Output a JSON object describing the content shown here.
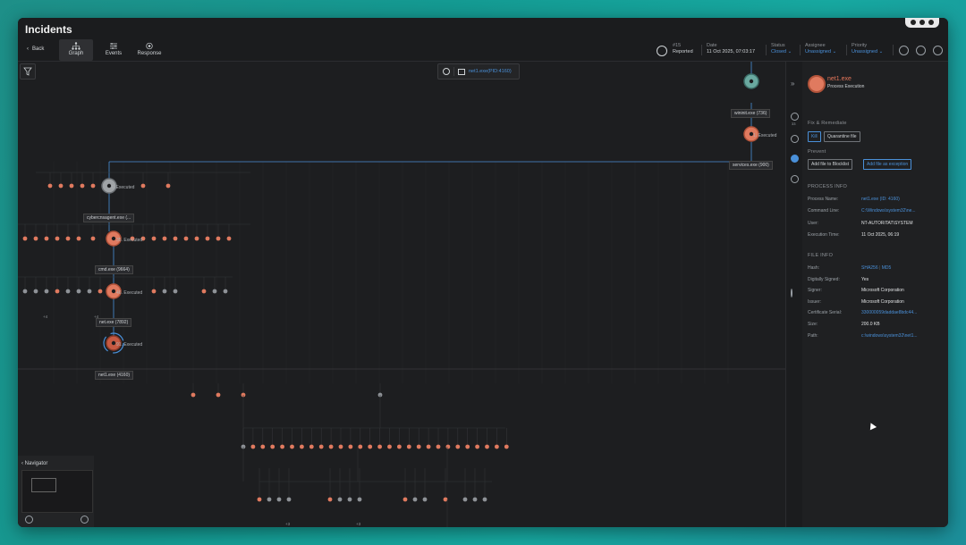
{
  "app": {
    "title": "Incidents"
  },
  "toolbar": {
    "back_label": "Back",
    "tabs": [
      {
        "label": "Graph",
        "icon": "graph-icon"
      },
      {
        "label": "Events",
        "icon": "events-icon"
      },
      {
        "label": "Response",
        "icon": "response-icon"
      }
    ],
    "incident_id": "#15",
    "incident_state": "Reported",
    "date_label": "Date",
    "date_value": "11 Oct 2025, 07:03:17",
    "status_label": "Status",
    "status_value": "Closed",
    "assignee_label": "Assignee",
    "assignee_value": "Unassigned",
    "priority_label": "Priority",
    "priority_value": "Unassigned"
  },
  "graph": {
    "search_text": "net1.exe(PID:4160)",
    "nodes": {
      "wininit": "wininit.exe (736)",
      "services": "services.exe (900)",
      "cybercns": "cybercnsagent.exe (...",
      "cmd": "cmd.exe (9664)",
      "net": "net.exe (7892)",
      "net1": "net1.exe (4160)"
    },
    "edges": {
      "e1": "1. Executed",
      "e7": "7. Executed",
      "e35": "35. Executed",
      "e46": "46. Executed",
      "e91": "91. Executed"
    },
    "plus_labels": [
      "+4",
      "+4",
      "+3",
      "+3"
    ]
  },
  "navigator": {
    "title": "Navigator"
  },
  "panel": {
    "title": "net1.exe",
    "subtitle": "Process Execution",
    "fix_title": "Fix & Remediate",
    "kill_label": "Kill",
    "quarantine_label": "Quarantine file",
    "prevent_title": "Prevent",
    "blocklist_label": "Add file to Blocklist",
    "exception_label": "Add file as exception",
    "process_info_title": "PROCESS INFO",
    "process_info": [
      {
        "label": "Process Name:",
        "value": "net1.exe (ID: 4160)",
        "link": true
      },
      {
        "label": "Command Line:",
        "value": "C:\\Windows\\system32\\ne...",
        "link": true
      },
      {
        "label": "User:",
        "value": "NT-AUTORITAT\\SYSTEM",
        "link": false
      },
      {
        "label": "Execution Time:",
        "value": "11 Oct 2025, 06:19",
        "link": false
      }
    ],
    "file_info_title": "FILE INFO",
    "hash_label": "Hash:",
    "hash_sha": "SHA256",
    "hash_md5": "MD5",
    "file_info": [
      {
        "label": "Digitally Signed:",
        "value": "Yes",
        "link": false
      },
      {
        "label": "Signer:",
        "value": "Microsoft Corporation",
        "link": false
      },
      {
        "label": "Issuer:",
        "value": "Microsoft Corporation",
        "link": false
      },
      {
        "label": "Certificate Serial:",
        "value": "330000059daddae8bdc44...",
        "link": true
      },
      {
        "label": "Size:",
        "value": "200.0 KB",
        "link": false
      },
      {
        "label": "Path:",
        "value": "c:\\windows\\system32\\net1...",
        "link": true
      }
    ],
    "iconcol_badge": "33"
  },
  "colors": {
    "accent": "#4a90d9",
    "node_orange": "#e07a5f",
    "node_grey": "#8e9297",
    "node_teal": "#6aa9a0"
  }
}
